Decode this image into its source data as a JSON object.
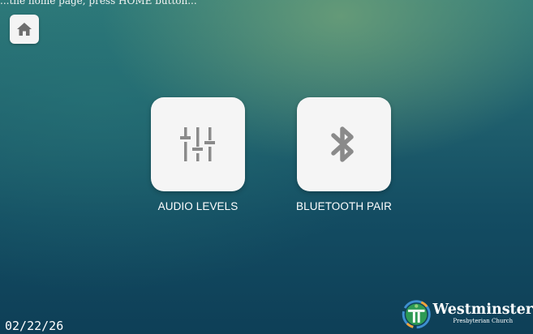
{
  "top_instruction": "...the home page, press HOME button...",
  "home_button": {
    "icon": "home-icon"
  },
  "tiles": [
    {
      "label": "AUDIO LEVELS",
      "icon": "sliders-icon"
    },
    {
      "label": "BLUETOOTH PAIR",
      "icon": "bluetooth-icon"
    }
  ],
  "date": "02/22/26",
  "logo": {
    "name": "Westminster",
    "subtitle": "Presbyterian Church"
  },
  "colors": {
    "tile_bg": "#f5f5f5",
    "icon_gray": "#8a8a8a",
    "logo_green": "#2e9a54"
  }
}
